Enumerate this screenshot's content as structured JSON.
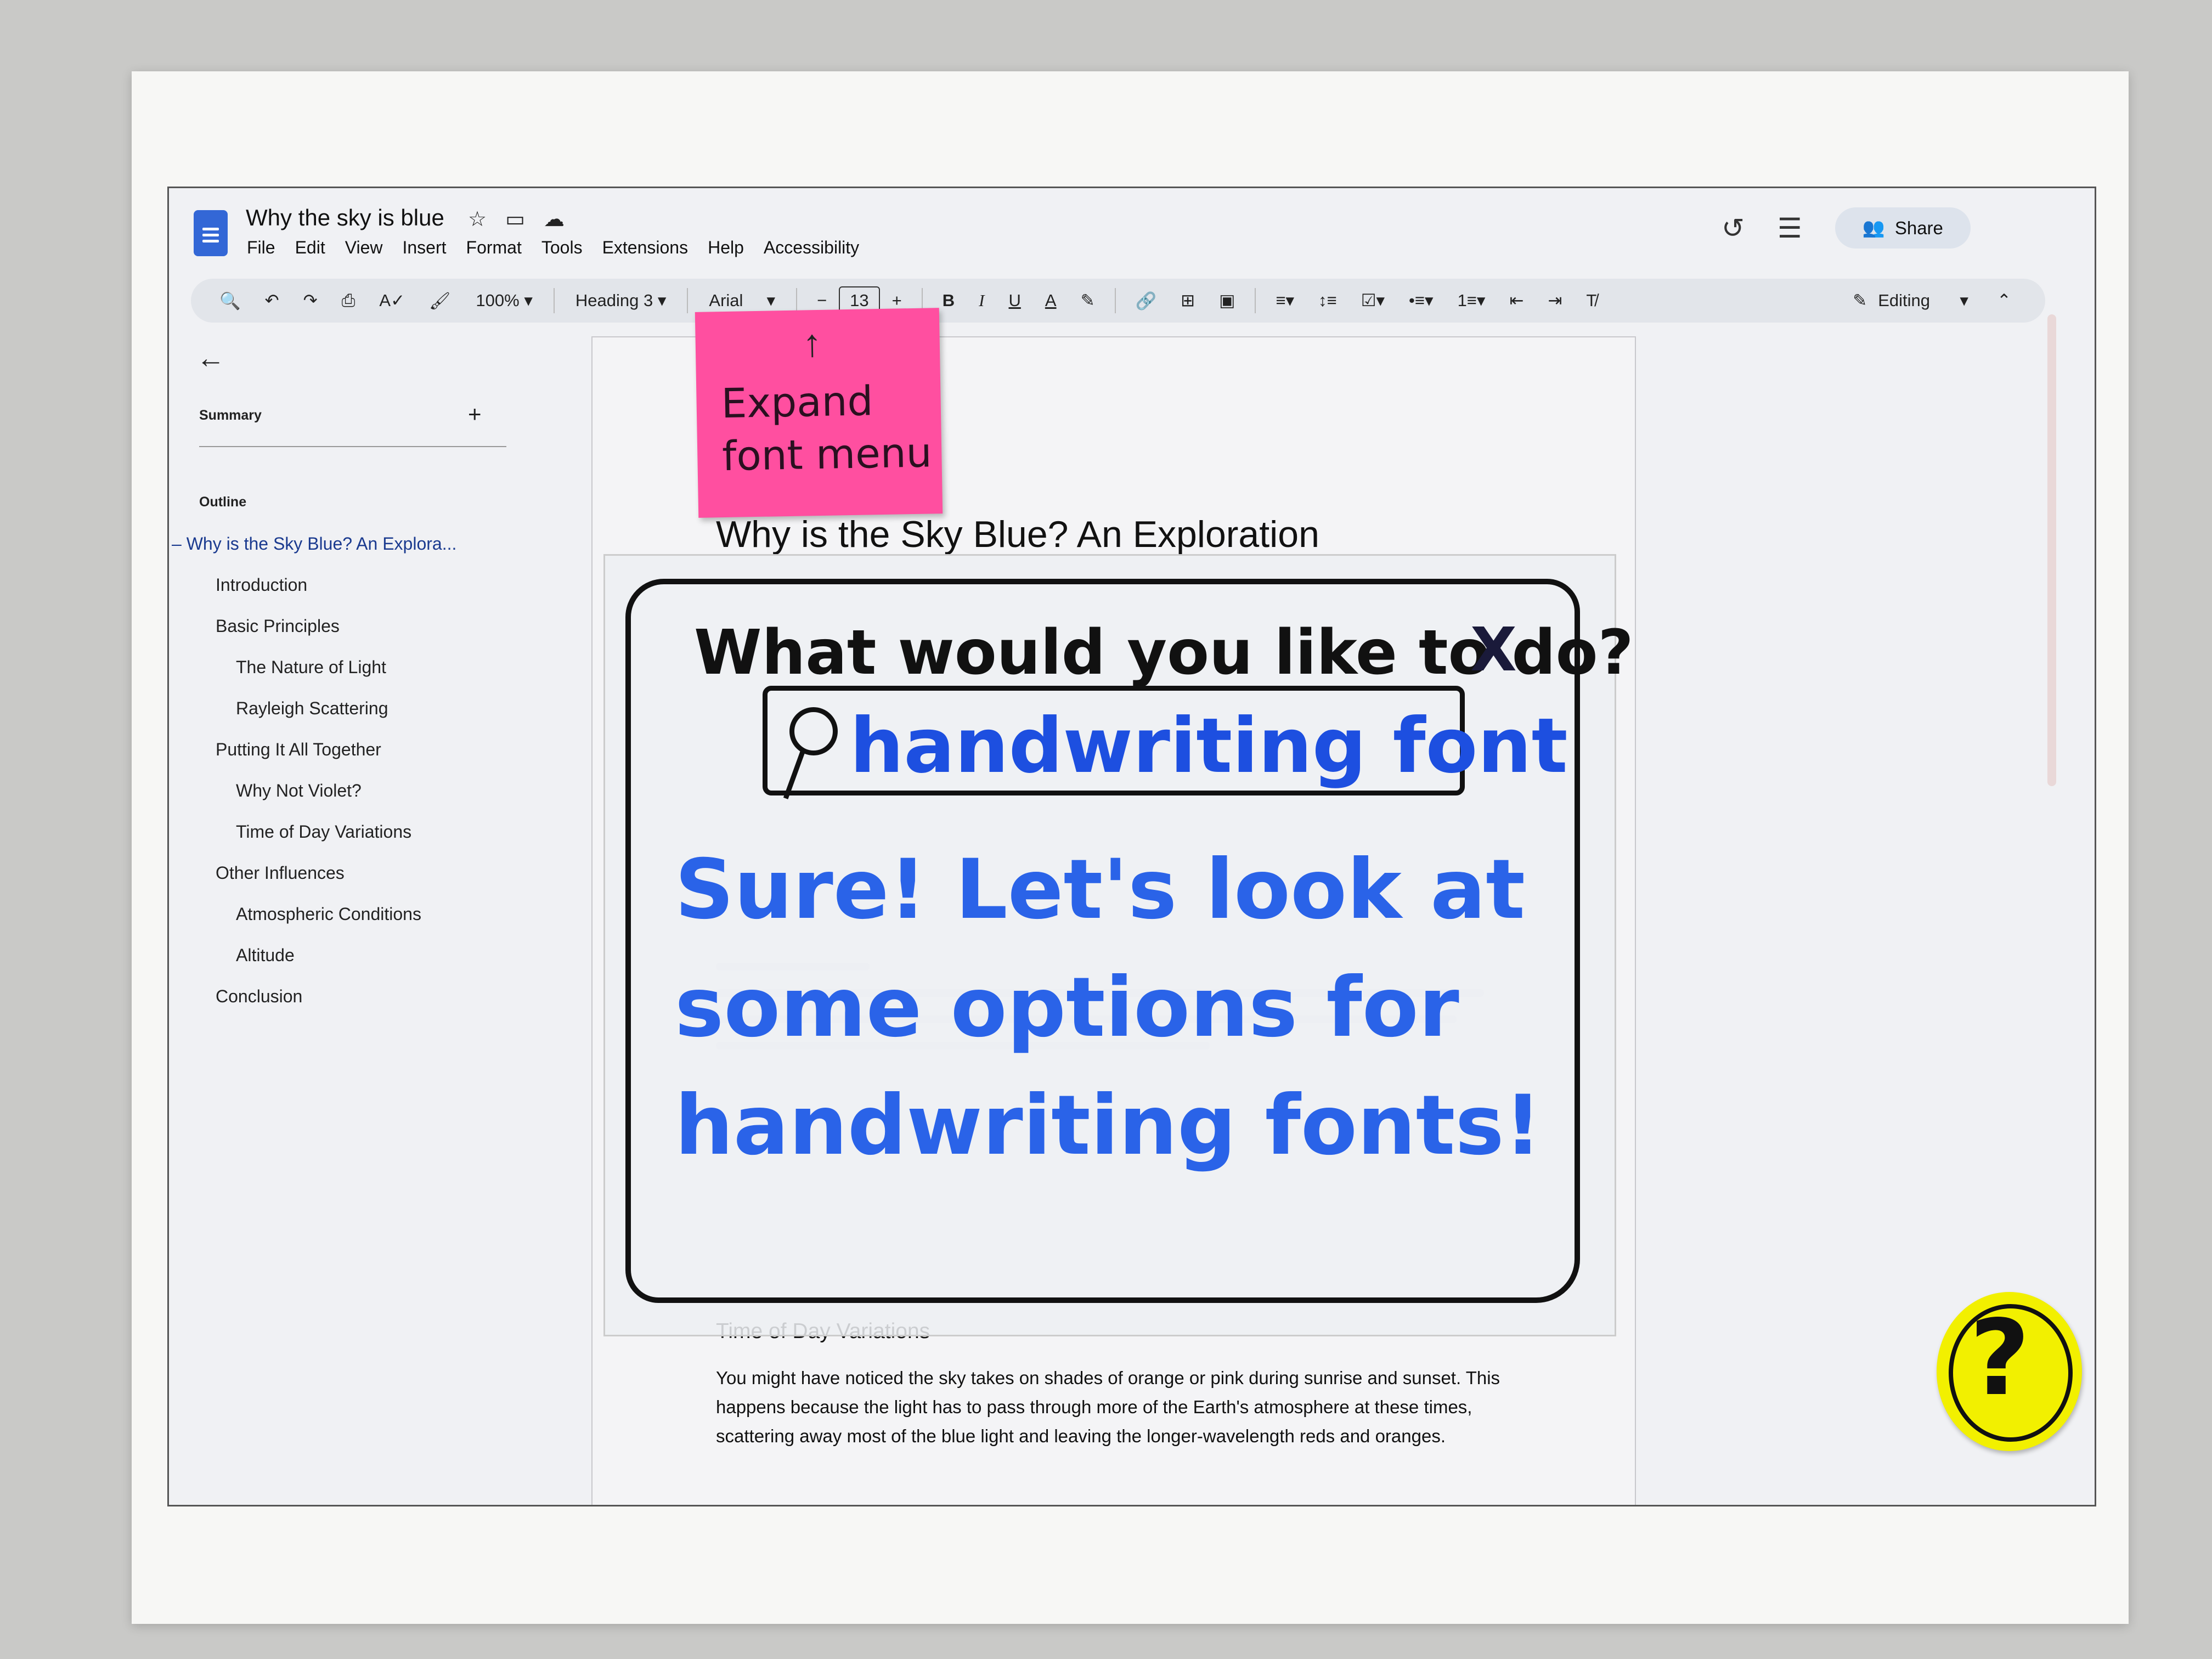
{
  "doc": {
    "title": "Why the sky is blue",
    "menus": [
      "File",
      "Edit",
      "View",
      "Insert",
      "Format",
      "Tools",
      "Extensions",
      "Help",
      "Accessibility"
    ],
    "share_label": "Share"
  },
  "toolbar": {
    "zoom": "100%",
    "style": "Heading 3",
    "font": "Arial",
    "font_size": "13",
    "mode": "Editing"
  },
  "sidebar": {
    "summary_label": "Summary",
    "outline_label": "Outline",
    "outline": [
      {
        "label": "Why is the Sky Blue? An Explora...",
        "level": 0,
        "active": true
      },
      {
        "label": "Introduction",
        "level": 1
      },
      {
        "label": "Basic Principles",
        "level": 1
      },
      {
        "label": "The Nature of Light",
        "level": 2
      },
      {
        "label": "Rayleigh Scattering",
        "level": 2
      },
      {
        "label": "Putting It All Together",
        "level": 1
      },
      {
        "label": "Why Not Violet?",
        "level": 2
      },
      {
        "label": "Time of Day Variations",
        "level": 2
      },
      {
        "label": "Other Influences",
        "level": 1
      },
      {
        "label": "Atmospheric Conditions",
        "level": 2
      },
      {
        "label": "Altitude",
        "level": 2
      },
      {
        "label": "Conclusion",
        "level": 1
      }
    ]
  },
  "document": {
    "heading": "Why is the Sky Blue? An Exploration",
    "subheading": "Time of Day Variations",
    "paragraph": "You might have noticed the sky takes on shades of orange or pink during sunrise and sunset. This happens because the light has to pass through more of the Earth's atmosphere at these times, scattering away most of the blue light and leaving the longer-wavelength reds and oranges."
  },
  "sticky_note": {
    "text_line1": "Expand",
    "text_line2": "font menu"
  },
  "dialog": {
    "question": "What would you like to do?",
    "close_glyph": "X",
    "search_value": "handwriting font",
    "reply": "Sure! Let's look at some options for handwriting fonts!"
  },
  "help_sticker": {
    "glyph": "?"
  },
  "colors": {
    "sticky": "#ff4fa0",
    "help": "#f2f000",
    "marker_blue": "#2a63e8",
    "doc_blue": "#3367d6"
  }
}
